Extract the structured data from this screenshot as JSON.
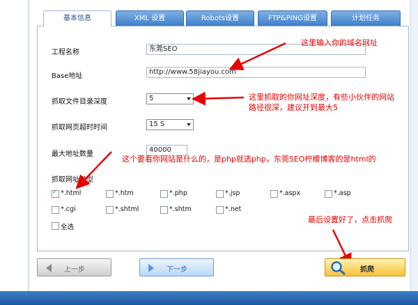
{
  "tabs": [
    {
      "label": "基本信息",
      "active": true
    },
    {
      "label": "XML 设置",
      "active": false
    },
    {
      "label": "Robots设置",
      "active": false
    },
    {
      "label": "FTP&PING设置",
      "active": false
    },
    {
      "label": "计划任务",
      "active": false
    }
  ],
  "form": {
    "project_name_label": "工程名称",
    "project_name_value": "东莞SEO",
    "base_url_label": "Base地址",
    "base_url_value": "http://www.58jiayou.com",
    "depth_label": "抓取文件目录深度",
    "depth_value": "5",
    "timeout_label": "抓取网页超时时间",
    "timeout_value": "15 S",
    "max_urls_label": "最大地址数量",
    "max_urls_value": "40000",
    "url_type_label": "抓取网址类型"
  },
  "file_types": [
    {
      "label": "*.html",
      "checked": true
    },
    {
      "label": "*.htm",
      "checked": false
    },
    {
      "label": "*.php",
      "checked": false
    },
    {
      "label": "*.jsp",
      "checked": false
    },
    {
      "label": "*.aspx",
      "checked": false
    },
    {
      "label": "*.asp",
      "checked": false
    },
    {
      "label": "*.cgi",
      "checked": false
    },
    {
      "label": "*.shtml",
      "checked": false
    },
    {
      "label": "*.shtm",
      "checked": false
    },
    {
      "label": "*.net",
      "checked": false
    },
    {
      "label": "全选",
      "checked": false
    }
  ],
  "annotations": {
    "domain_hint": "这里输入你的域名网址",
    "depth_hint_line1": "这里抓取的你网址深度，有些小伙伴的网站",
    "depth_hint_line2": "路径很深，建议开到最大5",
    "type_hint": "这个要看你网站是什么的，是php就选php，东莞SEO柠檬博客的是html的",
    "crawl_hint": "最后设置好了，点击抓爬"
  },
  "buttons": {
    "prev": "上一步",
    "next": "下一步",
    "crawl": "抓爬"
  },
  "colors": {
    "annotation": "#e60000",
    "tab_blue": "#3f7fca",
    "crawl_button": "#f6c23c",
    "taskbar": "#1e56a0"
  }
}
